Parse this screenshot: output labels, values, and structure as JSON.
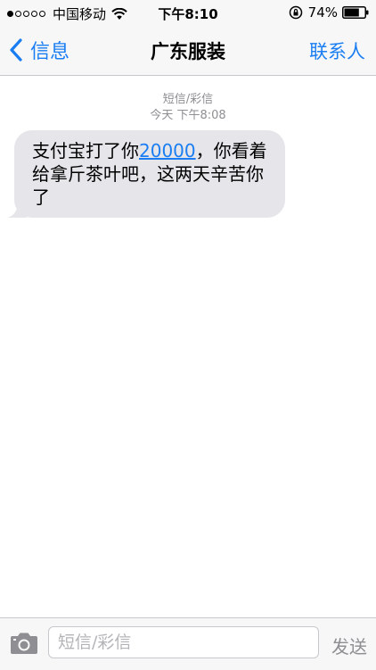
{
  "status_bar": {
    "signal_filled": 1,
    "signal_total": 5,
    "carrier": "中国移动",
    "time": "下午8:10",
    "battery_percent": "74%",
    "battery_level": 0.74,
    "icons": [
      "wifi-icon",
      "rotation-lock-icon",
      "battery-icon"
    ]
  },
  "nav": {
    "back_label": "信息",
    "title": "广东服装",
    "contact_label": "联系人"
  },
  "messages": {
    "type_label": "短信/彩信",
    "timestamp": "今天 下午8:08",
    "items": [
      {
        "text_before": "支付宝打了你",
        "link_text": "20000",
        "text_after": "，你看着给拿斤茶叶吧，这两天辛苦你了"
      }
    ]
  },
  "input_bar": {
    "placeholder": "短信/彩信",
    "value": "",
    "send_label": "发送"
  },
  "colors": {
    "accent": "#1a7ef2",
    "bubble": "#e5e5ea",
    "meta_text": "#8e8e93",
    "bar_bg": "#f7f7f7"
  }
}
